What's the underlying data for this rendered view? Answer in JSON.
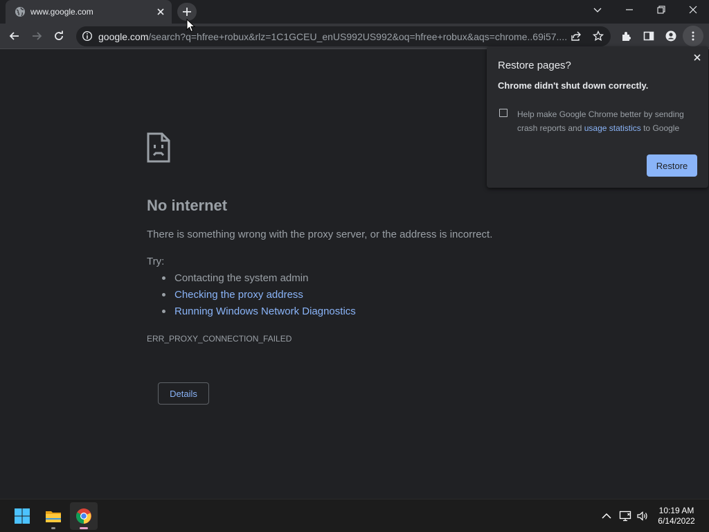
{
  "browser": {
    "tab": {
      "title": "www.google.com",
      "favicon": "globe-icon",
      "close_icon": "close-icon"
    },
    "new_tab_icon": "plus-icon",
    "window_controls": [
      "chevron-down-icon",
      "minimize-icon",
      "restore-icon",
      "close-icon"
    ],
    "toolbar": {
      "back_icon": "arrow-left-icon",
      "forward_icon": "arrow-right-icon",
      "reload_icon": "reload-icon",
      "url_host": "google.com",
      "url_rest": "/search?q=hfree+robux&rlz=1C1GCEU_enUS992US992&oq=hfree+robux&aqs=chrome..69i57....",
      "actions": [
        "share-icon",
        "star-icon",
        "extensions-icon",
        "side-panel-icon",
        "profile-icon",
        "menu-icon"
      ]
    }
  },
  "error_page": {
    "title": "No internet",
    "description": "There is something wrong with the proxy server, or the address is incorrect.",
    "try_label": "Try:",
    "suggestions": [
      {
        "text": "Contacting the system admin",
        "is_link": false
      },
      {
        "text": "Checking the proxy address",
        "is_link": true
      },
      {
        "text": "Running Windows Network Diagnostics",
        "is_link": true
      }
    ],
    "error_code": "ERR_PROXY_CONNECTION_FAILED",
    "details_label": "Details"
  },
  "restore_bubble": {
    "title": "Restore pages?",
    "message": "Chrome didn't shut down correctly.",
    "checkbox_checked": false,
    "help_text_before": "Help make Google Chrome better by sending crash reports and ",
    "help_link": "usage statistics",
    "help_text_after": " to Google",
    "restore_label": "Restore"
  },
  "taskbar": {
    "apps": [
      "windows-start-icon",
      "file-explorer-icon",
      "chrome-icon"
    ],
    "tray": [
      "chevron-up-icon",
      "network-icon",
      "volume-icon"
    ],
    "time": "10:19 AM",
    "date": "6/14/2022"
  },
  "colors": {
    "background": "#202124",
    "toolbar": "#35363a",
    "link": "#8ab4f8",
    "muted_text": "#9aa0a6",
    "accent_button": "#8ab4f8"
  }
}
